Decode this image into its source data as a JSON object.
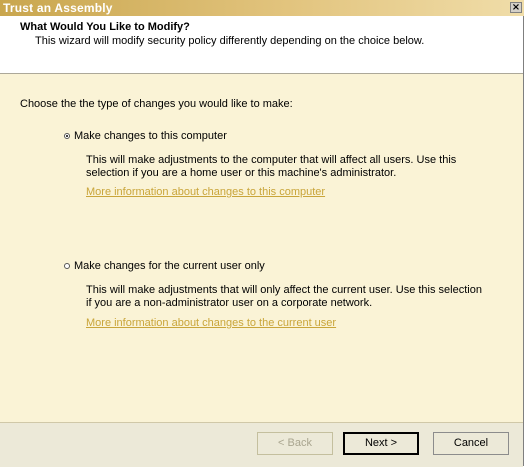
{
  "window": {
    "title": "Trust an Assembly",
    "close_glyph": "×"
  },
  "header": {
    "title": "What Would You Like to Modify?",
    "subtitle": "This wizard will modify security policy differently depending on the choice below."
  },
  "main": {
    "prompt": "Choose the the type of changes you would like to make:",
    "options": [
      {
        "label": "Make changes to this computer",
        "selected": true,
        "description": "This will make adjustments to the computer that will affect all users.  Use this selection if you are a home user or this machine's administrator.",
        "link": "More information about changes to this computer"
      },
      {
        "label": "Make changes for the current user only",
        "selected": false,
        "description": "This will make adjustments that will only affect the current user.  Use this selection if you are a non-administrator user on a corporate network.",
        "link": "More information about changes to the current user"
      }
    ]
  },
  "footer": {
    "back_label": "< Back",
    "next_label": "Next >",
    "cancel_label": "Cancel"
  },
  "colors": {
    "titlebar": "#c9a64e",
    "body_bg": "#faf3d6",
    "link": "#c9a53a"
  }
}
